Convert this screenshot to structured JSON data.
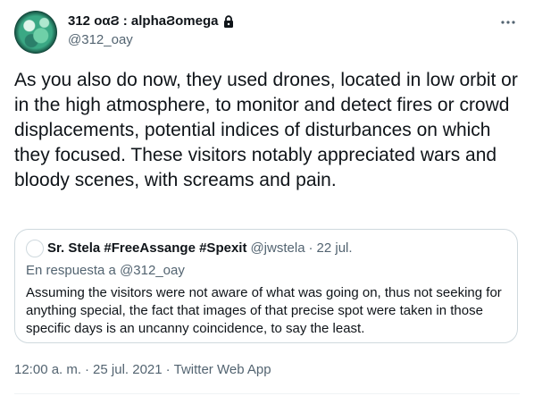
{
  "author": {
    "display_name": "312 οαϨ : alphaϨomega",
    "handle": "@312_oay"
  },
  "icons": {
    "lock": "lock-icon",
    "more": "more-horizontal-icon"
  },
  "tweet": {
    "text": "As you also do now, they used drones, located in low orbit or in the high atmosphere, to monitor and detect fires or crowd displacements, potential indices of disturbances on which they focused. These visitors notably appreciated wars and bloody scenes, with screams and pain."
  },
  "quoted_tweet": {
    "display_name": "Sr. Stela #FreeAssange #Spexit",
    "handle": "@jwstela",
    "separator": "·",
    "date": "22 jul.",
    "reply_context": "En respuesta a @312_oay",
    "text": "Assuming the visitors were not aware of what was going on, thus not seeking for anything special, the fact that images of that precise spot were taken in those specific days is an uncanny coincidence, to say the least."
  },
  "meta": {
    "time": "12:00 a. m.",
    "separator": "·",
    "date": "25 jul. 2021",
    "source": "Twitter Web App"
  },
  "colors": {
    "text_primary": "#0f1419",
    "text_secondary": "#536471",
    "border": "#cfd9de"
  }
}
